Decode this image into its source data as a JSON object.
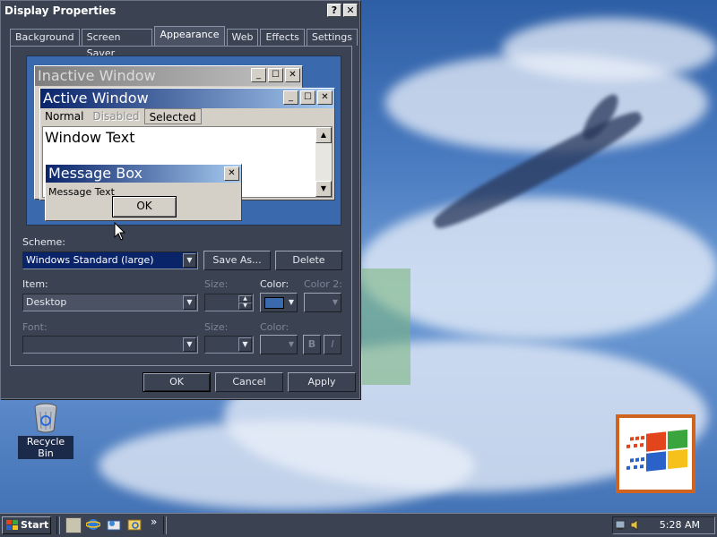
{
  "dialog": {
    "title": "Display Properties",
    "help_label": "?",
    "close_label": "✕",
    "tabs": [
      {
        "label": "Background",
        "active": false
      },
      {
        "label": "Screen Saver",
        "active": false
      },
      {
        "label": "Appearance",
        "active": true
      },
      {
        "label": "Web",
        "active": false
      },
      {
        "label": "Effects",
        "active": false
      },
      {
        "label": "Settings",
        "active": false
      }
    ],
    "preview": {
      "inactive_title": "Inactive Window",
      "active_title": "Active Window",
      "menu_normal": "Normal",
      "menu_disabled": "Disabled",
      "menu_selected": "Selected",
      "window_text": "Window Text",
      "msgbox_title": "Message Box",
      "msgbox_text": "Message Text",
      "msgbox_ok": "OK"
    },
    "scheme_label": "Scheme:",
    "scheme_value": "Windows Standard (large)",
    "save_as": "Save As...",
    "delete": "Delete",
    "item_label": "Item:",
    "item_value": "Desktop",
    "size_label": "Size:",
    "color_label": "Color:",
    "color2_label": "Color 2:",
    "font_label": "Font:",
    "font_size_label": "Size:",
    "font_color_label": "Color:",
    "bold_label": "B",
    "italic_label": "I",
    "ok": "OK",
    "cancel": "Cancel",
    "apply": "Apply",
    "desktop_color": "#3a6aad"
  },
  "desktop": {
    "recycle_bin": "Recycle Bin"
  },
  "taskbar": {
    "start": "Start",
    "chevron": "»",
    "clock": "5:28 AM"
  }
}
